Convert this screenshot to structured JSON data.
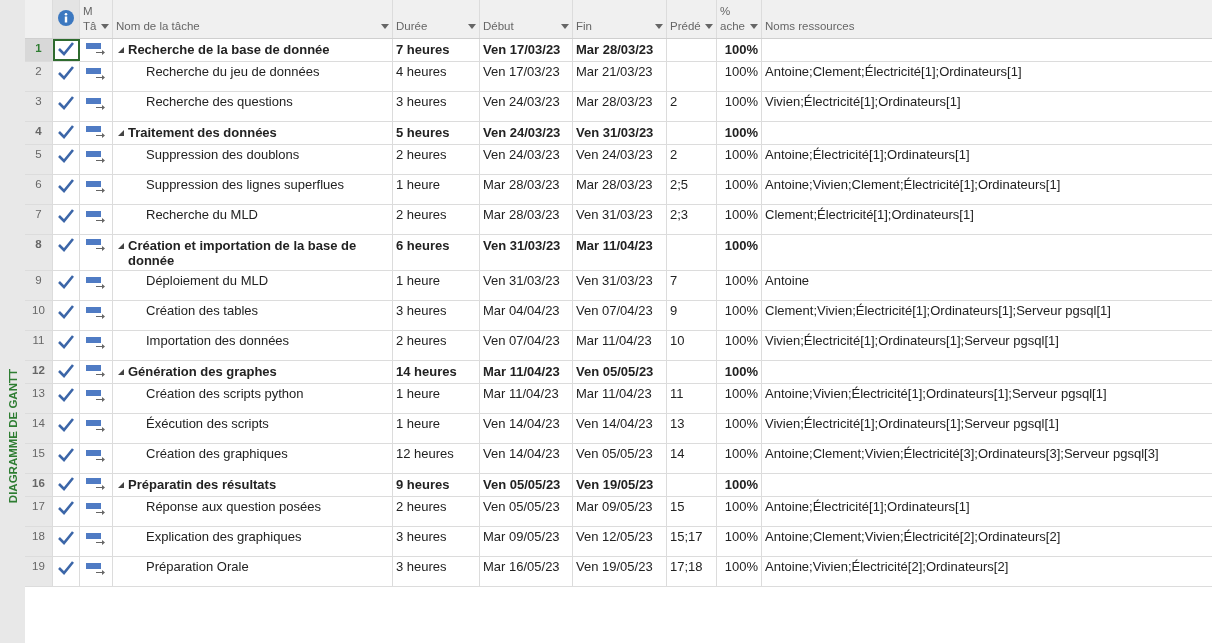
{
  "side_label": "DIAGRAMME DE GANTT",
  "columns": [
    {
      "label": "M\nTâ",
      "dropdown": true
    },
    {
      "label": "Nom de la tâche",
      "dropdown": true
    },
    {
      "label": "Durée",
      "dropdown": true
    },
    {
      "label": "Début",
      "dropdown": true
    },
    {
      "label": "Fin",
      "dropdown": true
    },
    {
      "label": "Prédé",
      "dropdown": true
    },
    {
      "label": "%\nache",
      "dropdown": true
    },
    {
      "label": "Noms ressources",
      "dropdown": false
    }
  ],
  "rows": [
    {
      "id": "1",
      "kind": "summary",
      "selected": true,
      "completed": true,
      "name": "Recherche de la base de donnée",
      "duration": "7 heures",
      "start": "Ven 17/03/23",
      "end": "Mar 28/03/23",
      "pred": "",
      "pct": "100%",
      "res": ""
    },
    {
      "id": "2",
      "kind": "task",
      "selected": false,
      "completed": true,
      "name": "Recherche du jeu de données",
      "duration": "4 heures",
      "start": "Ven 17/03/23",
      "end": "Mar 21/03/23",
      "pred": "",
      "pct": "100%",
      "res": "Antoine;Clement;Électricité[1];Ordinateurs[1]"
    },
    {
      "id": "3",
      "kind": "task",
      "selected": false,
      "completed": true,
      "name": "Recherche des questions",
      "duration": "3 heures",
      "start": "Ven 24/03/23",
      "end": "Mar 28/03/23",
      "pred": "2",
      "pct": "100%",
      "res": "Vivien;Électricité[1];Ordinateurs[1]"
    },
    {
      "id": "4",
      "kind": "summary",
      "selected": false,
      "completed": true,
      "name": "Traitement des données",
      "duration": "5 heures",
      "start": "Ven 24/03/23",
      "end": "Ven 31/03/23",
      "pred": "",
      "pct": "100%",
      "res": ""
    },
    {
      "id": "5",
      "kind": "task",
      "selected": false,
      "completed": true,
      "name": "Suppression des doublons",
      "duration": "2 heures",
      "start": "Ven 24/03/23",
      "end": "Ven 24/03/23",
      "pred": "2",
      "pct": "100%",
      "res": "Antoine;Électricité[1];Ordinateurs[1]"
    },
    {
      "id": "6",
      "kind": "task",
      "selected": false,
      "completed": true,
      "name": "Suppression des lignes superflues",
      "duration": "1 heure",
      "start": "Mar 28/03/23",
      "end": "Mar 28/03/23",
      "pred": "2;5",
      "pct": "100%",
      "res": "Antoine;Vivien;Clement;Électricité[1];Ordinateurs[1]"
    },
    {
      "id": "7",
      "kind": "task",
      "selected": false,
      "completed": true,
      "name": "Recherche du MLD",
      "duration": "2 heures",
      "start": "Mar 28/03/23",
      "end": "Ven 31/03/23",
      "pred": "2;3",
      "pct": "100%",
      "res": "Clement;Électricité[1];Ordinateurs[1]"
    },
    {
      "id": "8",
      "kind": "summary",
      "selected": false,
      "completed": true,
      "name": "Création et importation de la base de donnée",
      "duration": "6 heures",
      "start": "Ven 31/03/23",
      "end": "Mar 11/04/23",
      "pred": "",
      "pct": "100%",
      "res": ""
    },
    {
      "id": "9",
      "kind": "task",
      "selected": false,
      "completed": true,
      "name": "Déploiement du MLD",
      "duration": "1 heure",
      "start": "Ven 31/03/23",
      "end": "Ven 31/03/23",
      "pred": "7",
      "pct": "100%",
      "res": "Antoine"
    },
    {
      "id": "10",
      "kind": "task",
      "selected": false,
      "completed": true,
      "name": "Création des tables",
      "duration": "3 heures",
      "start": "Mar 04/04/23",
      "end": "Ven 07/04/23",
      "pred": "9",
      "pct": "100%",
      "res": "Clement;Vivien;Électricité[1];Ordinateurs[1];Serveur pgsql[1]"
    },
    {
      "id": "11",
      "kind": "task",
      "selected": false,
      "completed": true,
      "name": "Importation des données",
      "duration": "2 heures",
      "start": "Ven 07/04/23",
      "end": "Mar 11/04/23",
      "pred": "10",
      "pct": "100%",
      "res": "Vivien;Électricité[1];Ordinateurs[1];Serveur pgsql[1]"
    },
    {
      "id": "12",
      "kind": "summary",
      "selected": false,
      "completed": true,
      "name": "Génération des graphes",
      "duration": "14 heures",
      "start": "Mar 11/04/23",
      "end": "Ven 05/05/23",
      "pred": "",
      "pct": "100%",
      "res": ""
    },
    {
      "id": "13",
      "kind": "task",
      "selected": false,
      "completed": true,
      "name": "Création des scripts python",
      "duration": "1 heure",
      "start": "Mar 11/04/23",
      "end": "Mar 11/04/23",
      "pred": "11",
      "pct": "100%",
      "res": "Antoine;Vivien;Électricité[1];Ordinateurs[1];Serveur pgsql[1]"
    },
    {
      "id": "14",
      "kind": "task",
      "selected": false,
      "completed": true,
      "name": "Éxécution des scripts",
      "duration": "1 heure",
      "start": "Ven 14/04/23",
      "end": "Ven 14/04/23",
      "pred": "13",
      "pct": "100%",
      "res": "Vivien;Électricité[1];Ordinateurs[1];Serveur pgsql[1]"
    },
    {
      "id": "15",
      "kind": "task",
      "selected": false,
      "completed": true,
      "name": "Création des graphiques",
      "duration": "12 heures",
      "start": "Ven 14/04/23",
      "end": "Ven 05/05/23",
      "pred": "14",
      "pct": "100%",
      "res": "Antoine;Clement;Vivien;Électricité[3];Ordinateurs[3];Serveur pgsql[3]"
    },
    {
      "id": "16",
      "kind": "summary",
      "selected": false,
      "completed": true,
      "name": "Préparatin des résultats",
      "duration": "9 heures",
      "start": "Ven 05/05/23",
      "end": "Ven 19/05/23",
      "pred": "",
      "pct": "100%",
      "res": ""
    },
    {
      "id": "17",
      "kind": "task",
      "selected": false,
      "completed": true,
      "name": "Réponse aux question posées",
      "duration": "2 heures",
      "start": "Ven 05/05/23",
      "end": "Mar 09/05/23",
      "pred": "15",
      "pct": "100%",
      "res": "Antoine;Électricité[1];Ordinateurs[1]"
    },
    {
      "id": "18",
      "kind": "task",
      "selected": false,
      "completed": true,
      "name": "Explication des graphiques",
      "duration": "3 heures",
      "start": "Mar 09/05/23",
      "end": "Ven 12/05/23",
      "pred": "15;17",
      "pct": "100%",
      "res": "Antoine;Clement;Vivien;Électricité[2];Ordinateurs[2]"
    },
    {
      "id": "19",
      "kind": "task",
      "selected": false,
      "completed": true,
      "name": "Préparation Orale",
      "duration": "3 heures",
      "start": "Mar 16/05/23",
      "end": "Ven 19/05/23",
      "pred": "17;18",
      "pct": "100%",
      "res": "Antoine;Vivien;Électricité[2];Ordinateurs[2]"
    }
  ]
}
